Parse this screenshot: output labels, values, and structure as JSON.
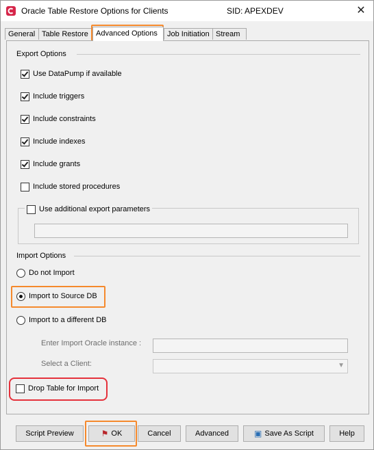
{
  "window": {
    "title": "Oracle Table Restore Options for Clients",
    "sid": "SID: APEXDEV",
    "close_glyph": "✕"
  },
  "tabs": [
    {
      "label": "General"
    },
    {
      "label": "Table Restore"
    },
    {
      "label": "Advanced Options"
    },
    {
      "label": "Job Initiation"
    },
    {
      "label": "Stream"
    }
  ],
  "export": {
    "title": "Export Options",
    "items": [
      {
        "label": "Use DataPump if available",
        "checked": true
      },
      {
        "label": "Include triggers",
        "checked": true
      },
      {
        "label": "Include constraints",
        "checked": true
      },
      {
        "label": "Include indexes",
        "checked": true
      },
      {
        "label": "Include grants",
        "checked": true
      },
      {
        "label": "Include stored procedures",
        "checked": false
      }
    ],
    "additional": {
      "label": "Use additional export parameters",
      "checked": false,
      "value": ""
    }
  },
  "import": {
    "title": "Import Options",
    "options": [
      {
        "label": "Do not Import",
        "selected": false
      },
      {
        "label": "Import to Source DB",
        "selected": true
      },
      {
        "label": "Import to a different DB",
        "selected": false
      }
    ],
    "instance_label": "Enter Import Oracle instance :",
    "instance_value": "",
    "client_label": "Select a Client:",
    "client_value": "",
    "drop_table": {
      "label": "Drop Table for Import",
      "checked": false
    }
  },
  "buttons": {
    "script_preview": "Script Preview",
    "ok": "OK",
    "cancel": "Cancel",
    "advanced": "Advanced",
    "save_as_script": "Save As Script",
    "help": "Help"
  },
  "colors": {
    "highlight_orange": "#f5892c",
    "highlight_red": "#e5303a"
  }
}
